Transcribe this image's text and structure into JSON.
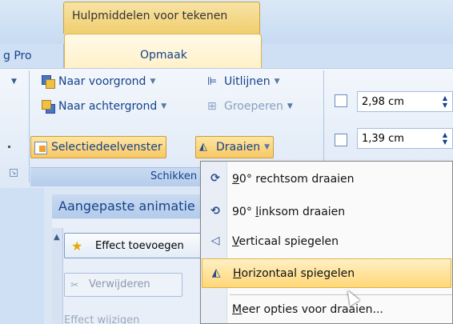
{
  "ribbon": {
    "context_header": "Hulpmiddelen voor tekenen",
    "tab_left": "g Pro",
    "tab_active": "Opmaak",
    "arrange": {
      "bring_forward": "Naar voorgrond",
      "send_backward": "Naar achtergrond",
      "selection_pane": "Selectiedeelvenster",
      "align": "Uitlijnen",
      "group": "Groeperen",
      "rotate": "Draaien",
      "group_label": "Schikken"
    },
    "size": {
      "height": "2,98 cm",
      "width": "1,39 cm"
    }
  },
  "pane": {
    "title": "Aangepaste animatie",
    "add_effect": "Effect toevoegen",
    "remove": "Verwijderen",
    "change_effect": "Effect wijzigen"
  },
  "menu": {
    "items": [
      {
        "pre": "",
        "u": "9",
        "post": "0° rechtsom draaien",
        "icon": "rotate-right-icon",
        "glyph": "⟳"
      },
      {
        "pre": "90° ",
        "u": "l",
        "post": "inksom draaien",
        "icon": "rotate-left-icon",
        "glyph": "⟲"
      },
      {
        "pre": "",
        "u": "V",
        "post": "erticaal spiegelen",
        "icon": "flip-vertical-icon",
        "glyph": "◁"
      },
      {
        "pre": "",
        "u": "H",
        "post": "orizontaal spiegelen",
        "icon": "flip-horizontal-icon",
        "glyph": "◭"
      },
      {
        "pre": "",
        "u": "M",
        "post": "eer opties voor draaien...",
        "icon": "",
        "glyph": ""
      }
    ]
  }
}
